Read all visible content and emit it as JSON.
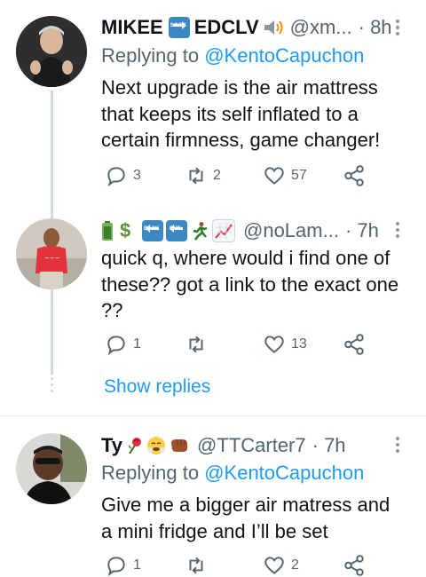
{
  "tweets": [
    {
      "name": "MIKEE",
      "name_tail": "EDCLV",
      "handle": "@xm...",
      "time": "· 8h",
      "replying_prefix": "Replying to",
      "replying_to": "@KentoCapuchon",
      "text": "Next upgrade is the air mattress that keeps its self inflated to a certain firmness, game changer!",
      "reply_count": "3",
      "retweet_count": "2",
      "like_count": "57",
      "emoji_icons": [
        "soon-arrow-icon",
        "speaker-icon"
      ]
    },
    {
      "name": "",
      "handle": "@noLam...",
      "time": "· 7h",
      "text": "quick q, where would i find one of these?? got a link to the exact one ??",
      "reply_count": "1",
      "retweet_count": "",
      "like_count": "13",
      "emoji_icons": [
        "battery-icon",
        "dollar-icon",
        "back-arrow-icon",
        "end-arrow-icon",
        "runner-icon",
        "chart-increasing-icon"
      ]
    },
    {
      "name": "Ty",
      "handle": "@TTCarter7",
      "time": "· 7h",
      "replying_prefix": "Replying to",
      "replying_to": "@KentoCapuchon",
      "text": "Give me a bigger air matress and a mini fridge and I’ll be set",
      "reply_count": "1",
      "retweet_count": "",
      "like_count": "2",
      "emoji_icons": [
        "rose-icon",
        "steaming-face-icon",
        "fist-bump-icon"
      ]
    }
  ],
  "show_replies_label": "Show replies",
  "emoji_labels": {
    "soon": "SOON",
    "back": "BACK",
    "end": "END",
    "dollar": "$"
  },
  "colors": {
    "text": "#0f1419",
    "muted": "#536471",
    "link": "#1d9bf0",
    "thread_line": "#cfd9de"
  }
}
